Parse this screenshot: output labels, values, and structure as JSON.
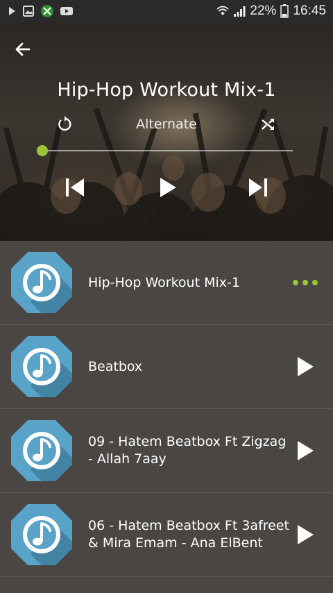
{
  "status_bar": {
    "battery_percent": "22%",
    "time": "16:45",
    "icons": [
      "play-icon",
      "gallery-icon",
      "xbox-icon",
      "youtube-icon",
      "wifi-icon",
      "signal-icon",
      "battery-icon"
    ]
  },
  "player": {
    "title": "Hip-Hop Workout Mix-1",
    "mode": "Alternate",
    "progress": 0.0,
    "icons": {
      "back": "arrow-left-icon",
      "repeat": "repeat-icon",
      "shuffle": "shuffle-icon",
      "prev": "skip-previous-icon",
      "play": "play-icon",
      "next": "skip-next-icon"
    }
  },
  "playlist": [
    {
      "title": "Hip-Hop Workout Mix-1",
      "state": "playing",
      "action_icon": "more-dots-icon"
    },
    {
      "title": "Beatbox",
      "state": "idle",
      "action_icon": "play-icon"
    },
    {
      "title": "09 - Hatem Beatbox Ft Zigzag - Allah 7aay",
      "state": "idle",
      "action_icon": "play-icon"
    },
    {
      "title": "06 - Hatem Beatbox Ft 3afreet & Mira Emam - Ana ElBent",
      "state": "idle",
      "action_icon": "play-icon"
    }
  ],
  "colors": {
    "accent": "#9bc43a",
    "list_background": "#4a4643",
    "thumb_circle": "#5aa3c8",
    "thumb_shadow": "#3f7f9f"
  }
}
